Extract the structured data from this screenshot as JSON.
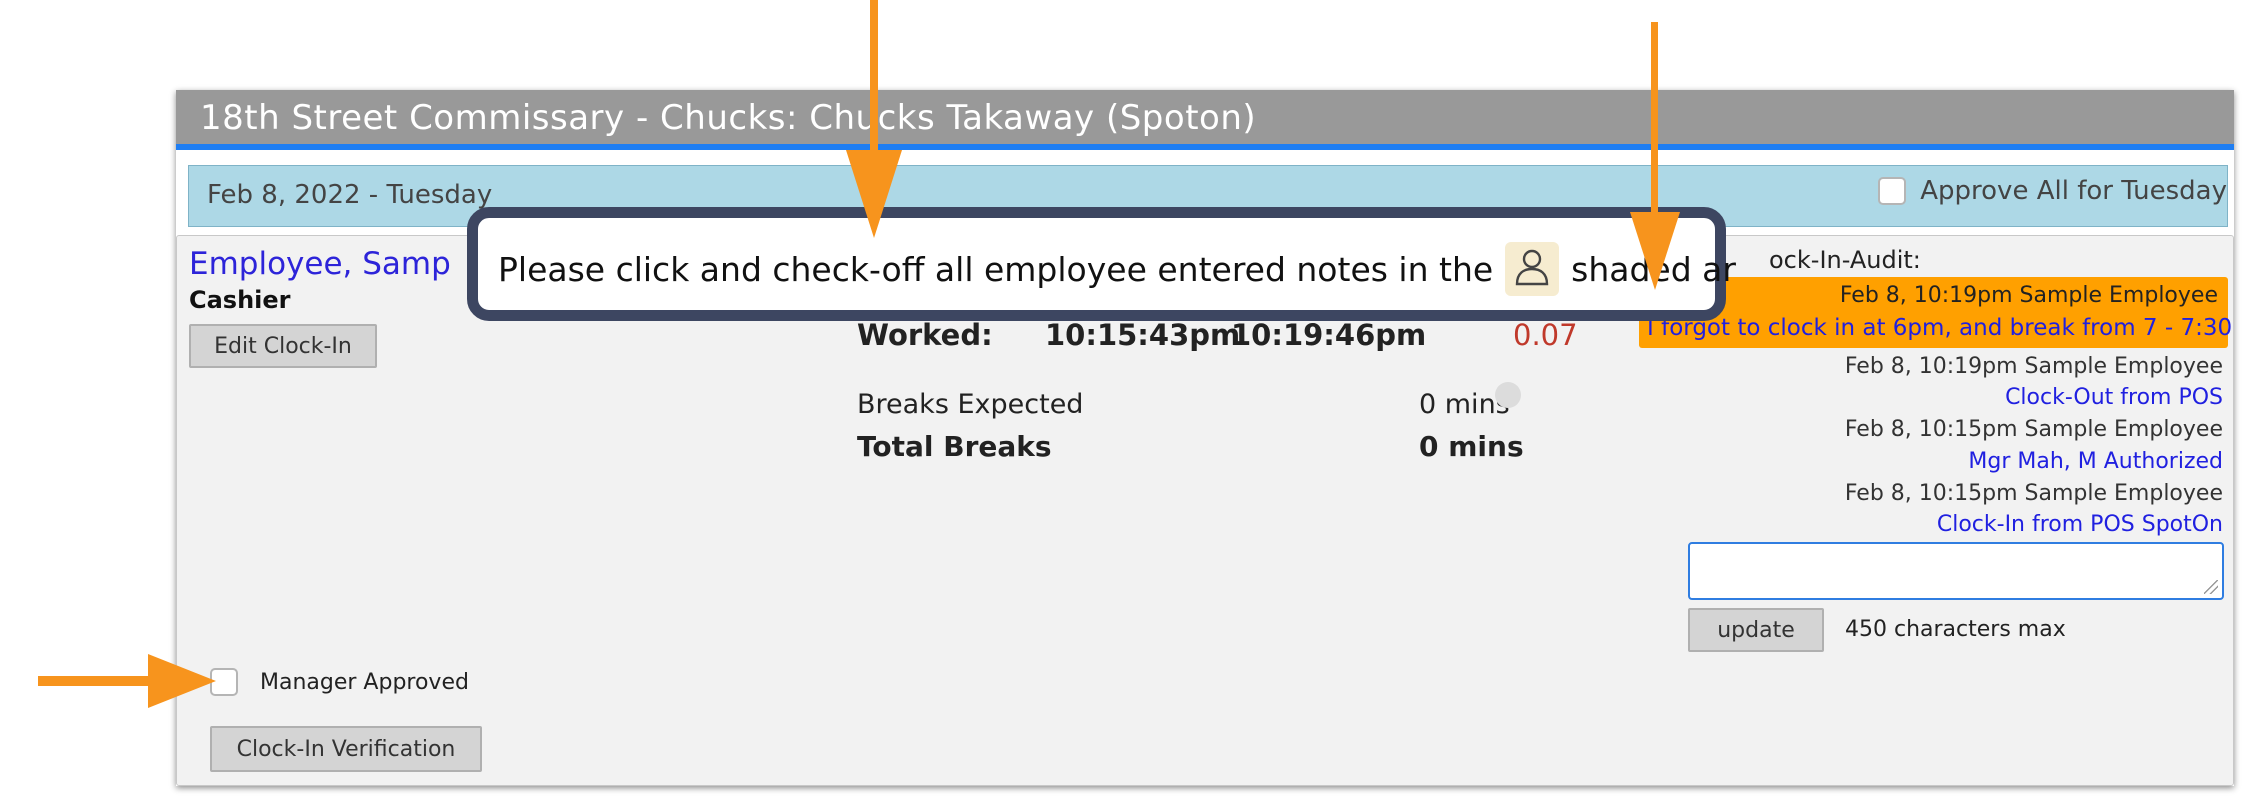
{
  "window": {
    "title": "18th Street Commissary - Chucks: Chucks Takaway (Spoton)",
    "date": "Feb 8, 2022 - Tuesday",
    "approve_all_label": "Approve All for Tuesday"
  },
  "employee": {
    "name": "Employee, Samp",
    "role": "Cashier",
    "edit_button": "Edit Clock-In"
  },
  "hours": {
    "worked_label": "Worked:",
    "clock_in": "10:15:43pm",
    "clock_out": "10:19:46pm",
    "hours": "0.07",
    "breaks_expected_label": "Breaks Expected",
    "breaks_expected_value": "0 mins",
    "total_breaks_label": "Total Breaks",
    "total_breaks_value": "0 mins"
  },
  "audit": {
    "heading": "ock-In-Audit:",
    "highlighted": {
      "meta": "Feb 8, 10:19pm Sample Employee",
      "note": "I forgot to clock in at 6pm, and break from 7 - 7:30"
    },
    "entries": [
      {
        "meta": "Feb 8, 10:19pm Sample Employee",
        "note": "Clock-Out from POS"
      },
      {
        "meta": "Feb 8, 10:15pm Sample Employee",
        "note": "Mgr Mah, M Authorized"
      },
      {
        "meta": "Feb 8, 10:15pm Sample Employee",
        "note": "Clock-In from POS SpotOn"
      }
    ],
    "update_button": "update",
    "max_chars": "450 characters max"
  },
  "approval": {
    "manager_approved_label": "Manager Approved",
    "verification_button": "Clock-In Verification"
  },
  "callout": {
    "text_before": "Please click and check-off all employee entered notes in the",
    "text_after": "shaded ar"
  },
  "colors": {
    "title_bar": "#999999",
    "accent_line": "#1f7ef2",
    "date_bar": "#add8e6",
    "highlight": "#ffa000",
    "arrow": "#f7941d",
    "link": "#2020e0",
    "hours_red": "#c0392b"
  },
  "icons": {
    "employee_note": "person-outline-icon",
    "arrow": "down-arrow-pointer"
  }
}
